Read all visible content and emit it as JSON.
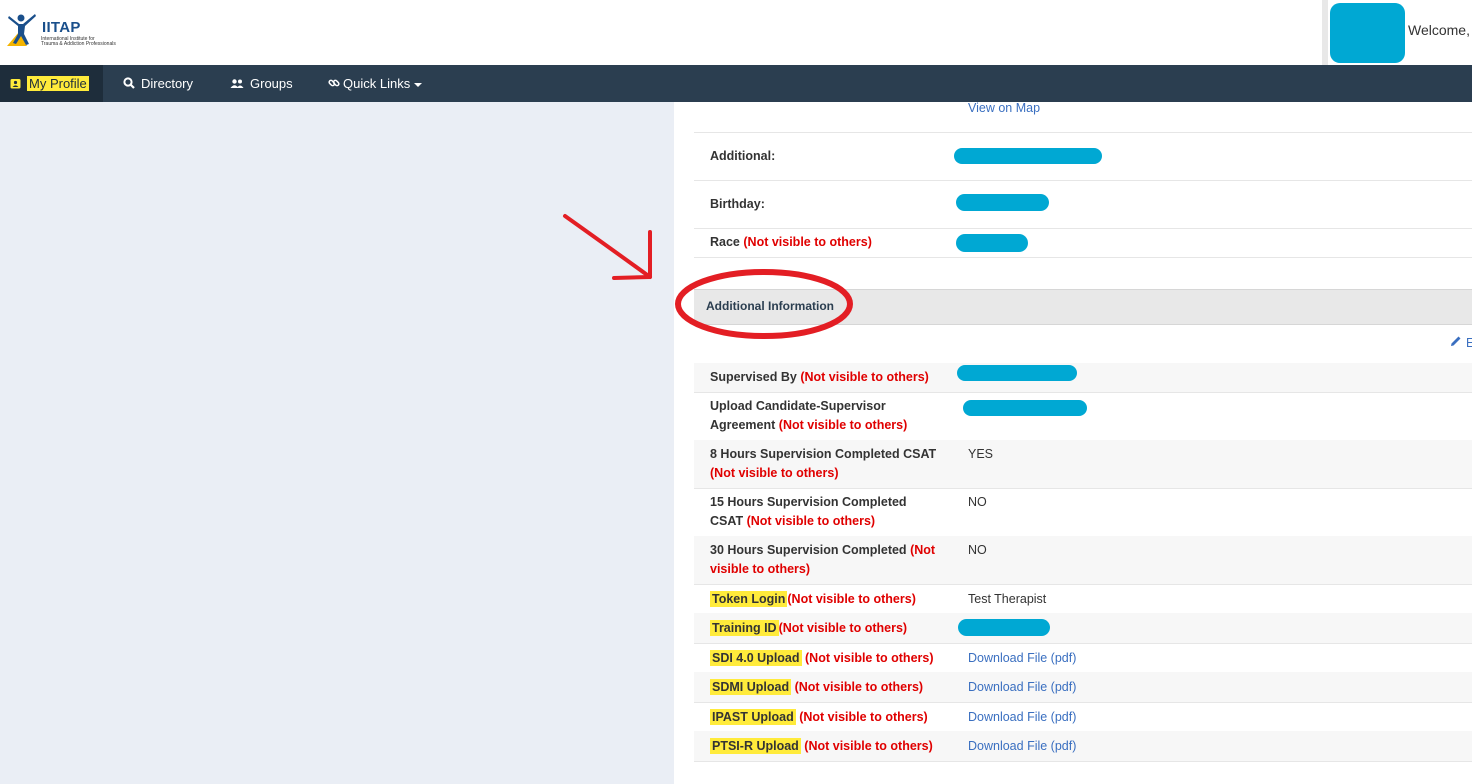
{
  "brand": {
    "title": "IITAP",
    "subtitle_line1": "International Institute for",
    "subtitle_line2": "Trauma & Addiction Professionals"
  },
  "header": {
    "welcome": "Welcome,"
  },
  "nav": {
    "items": [
      {
        "label": "My Profile",
        "icon": "id-badge-icon"
      },
      {
        "label": "Directory",
        "icon": "search-icon"
      },
      {
        "label": "Groups",
        "icon": "users-icon"
      },
      {
        "label": "Quick Links",
        "icon": "link-icon"
      }
    ]
  },
  "profile": {
    "map_link": "View on Map",
    "additional_label": "Additional:",
    "birthday_label": "Birthday:",
    "race_label": "Race"
  },
  "section": {
    "title": "Additional Information",
    "edit_label": "E"
  },
  "not_visible": "(Not visible to others)",
  "fields": [
    {
      "label": "Supervised By",
      "value": ""
    },
    {
      "label": "Upload Candidate-Supervisor Agreement",
      "value": ""
    },
    {
      "label": "8 Hours Supervision Completed CSAT",
      "value": "YES"
    },
    {
      "label": "15 Hours Supervision Completed CSAT",
      "value": "NO"
    },
    {
      "label": "30 Hours Supervision Completed",
      "value": "NO"
    },
    {
      "label": "Token Login",
      "value": "Test Therapist"
    },
    {
      "label": "Training ID",
      "value": ""
    },
    {
      "label": "SDI 4.0 Upload",
      "value": "Download File (pdf)"
    },
    {
      "label": "SDMI Upload",
      "value": "Download File (pdf)"
    },
    {
      "label": "IPAST Upload",
      "value": "Download File (pdf)"
    },
    {
      "label": "PTSI-R Upload",
      "value": "Download File (pdf)"
    }
  ],
  "colors": {
    "nav_bg": "#2b3e50",
    "highlight": "#ffeb3b",
    "redaction": "#00a8d3",
    "not_visible_red": "#e00000",
    "annotation_red": "#e31e24",
    "link": "#3a6fc0"
  }
}
